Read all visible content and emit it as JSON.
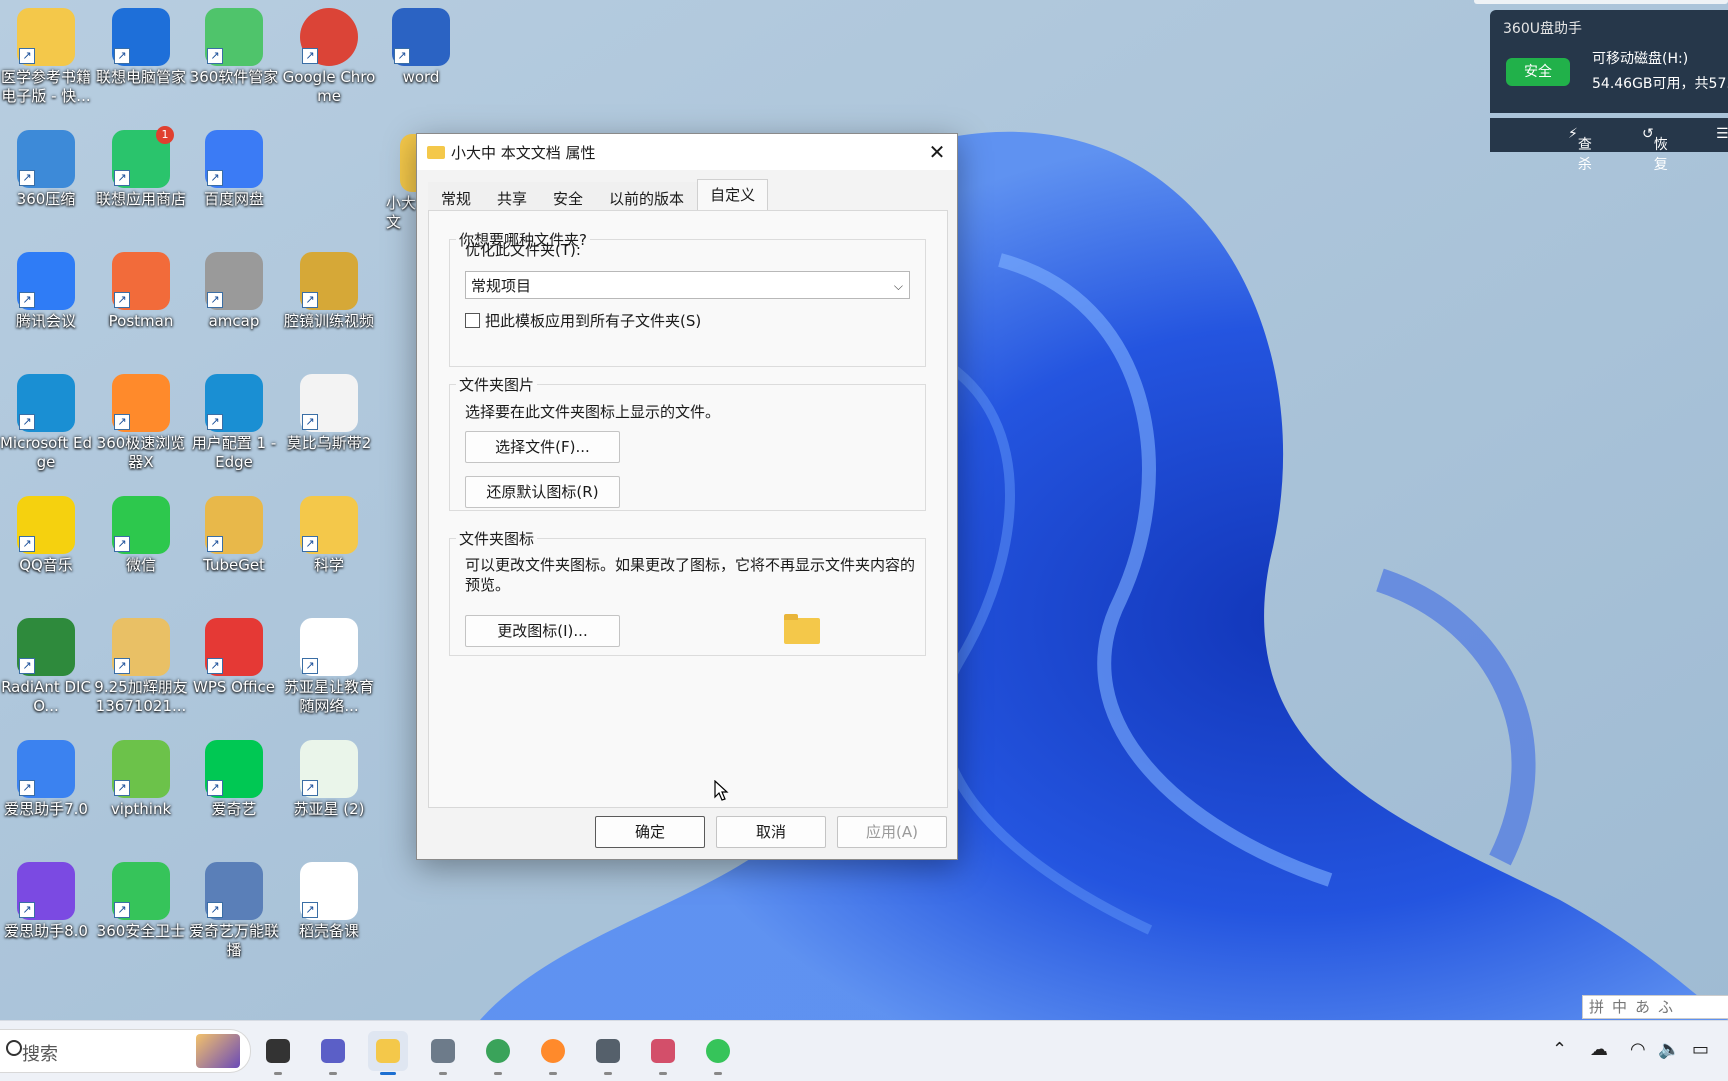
{
  "desktop": {
    "icons": [
      {
        "label": "医学参考书籍电子版 - 快...",
        "icon": "folder-icon",
        "color": "#f4c84a",
        "badge": ""
      },
      {
        "label": "联想电脑管家",
        "icon": "lenovo-pc-manager-icon",
        "color": "#1e6fd9",
        "badge": ""
      },
      {
        "label": "360软件管家",
        "icon": "360-software-manager-icon",
        "color": "#4fc46b",
        "badge": ""
      },
      {
        "label": "Google Chrome",
        "icon": "chrome-icon",
        "color": "#db4437",
        "badge": ""
      },
      {
        "label": "word",
        "icon": "word-document-icon",
        "color": "#2b63c3",
        "badge": ""
      },
      {
        "label": "360压缩",
        "icon": "360-zip-icon",
        "color": "#3d8ad8",
        "badge": ""
      },
      {
        "label": "联想应用商店",
        "icon": "lenovo-app-store-icon",
        "color": "#2ac46c",
        "badge": "1"
      },
      {
        "label": "百度网盘",
        "icon": "baidu-netdisk-icon",
        "color": "#3b7bf5",
        "badge": ""
      },
      {
        "label": "腾讯会议",
        "icon": "tencent-meeting-icon",
        "color": "#2f7cf6",
        "badge": ""
      },
      {
        "label": "Postman",
        "icon": "postman-icon",
        "color": "#f26b3a",
        "badge": ""
      },
      {
        "label": "amcap",
        "icon": "amcap-camera-icon",
        "color": "#9a9a9a",
        "badge": ""
      },
      {
        "label": "腔镜训练视频",
        "icon": "folder-icon",
        "color": "#d6a837",
        "badge": ""
      },
      {
        "label": "Microsoft Edge",
        "icon": "edge-icon",
        "color": "#1a8fd3",
        "badge": ""
      },
      {
        "label": "360极速浏览器X",
        "icon": "360-browser-icon",
        "color": "#ff8a2b",
        "badge": ""
      },
      {
        "label": "用户配置 1 - Edge",
        "icon": "edge-profile-icon",
        "color": "#1a8fd3",
        "badge": ""
      },
      {
        "label": "莫比乌斯带2",
        "icon": "image-file-icon",
        "color": "#f3f3f3",
        "badge": ""
      },
      {
        "label": "QQ音乐",
        "icon": "qq-music-icon",
        "color": "#f5d10f",
        "badge": ""
      },
      {
        "label": "微信",
        "icon": "wechat-icon",
        "color": "#2dc84d",
        "badge": ""
      },
      {
        "label": "TubeGet",
        "icon": "folder-icon",
        "color": "#e8b84a",
        "badge": ""
      },
      {
        "label": "科学",
        "icon": "folder-icon",
        "color": "#f4c84a",
        "badge": ""
      },
      {
        "label": "RadiAnt DICO...",
        "icon": "radiant-dicom-icon",
        "color": "#2e8a3c",
        "badge": ""
      },
      {
        "label": "9.25加辉朋友13671021...",
        "icon": "folder-icon",
        "color": "#e9c065",
        "badge": ""
      },
      {
        "label": "WPS Office",
        "icon": "wps-office-icon",
        "color": "#e53935",
        "badge": ""
      },
      {
        "label": "苏亚星让教育随网络...",
        "icon": "qr-code-icon",
        "color": "#ffffff",
        "badge": ""
      },
      {
        "label": "爱思助手7.0",
        "icon": "i4-assistant-icon",
        "color": "#3b82f0",
        "badge": ""
      },
      {
        "label": "vipthink",
        "icon": "vipthink-icon",
        "color": "#6cc24a",
        "badge": ""
      },
      {
        "label": "爱奇艺",
        "icon": "iqiyi-icon",
        "color": "#00c853",
        "badge": ""
      },
      {
        "label": "苏亚星 (2)",
        "icon": "png-file-icon",
        "color": "#eaf5ea",
        "badge": ""
      },
      {
        "label": "爱思助手8.0",
        "icon": "i4-assistant-icon",
        "color": "#7b4ae2",
        "badge": ""
      },
      {
        "label": "360安全卫士",
        "icon": "360-security-icon",
        "color": "#36c45a",
        "badge": ""
      },
      {
        "label": "爱奇艺万能联播",
        "icon": "iqiyi-player-icon",
        "color": "#5a7fb8",
        "badge": ""
      },
      {
        "label": "稻壳备课",
        "icon": "document-file-icon",
        "color": "#ffffff",
        "badge": ""
      }
    ],
    "partial_icon_label": "小大\n文"
  },
  "dialog": {
    "title": "小大中 本文文档 属性",
    "tabs": [
      "常规",
      "共享",
      "安全",
      "以前的版本",
      "自定义"
    ],
    "active_tab": "自定义",
    "group1": {
      "legend": "你想要哪种文件夹?",
      "optimize_label": "优化此文件夹(T):",
      "optimize_value": "常规项目",
      "apply_template_label": "把此模板应用到所有子文件夹(S)",
      "apply_template_checked": false
    },
    "group2": {
      "legend": "文件夹图片",
      "desc": "选择要在此文件夹图标上显示的文件。",
      "choose_button": "选择文件(F)...",
      "restore_button": "还原默认图标(R)"
    },
    "group3": {
      "legend": "文件夹图标",
      "desc": "可以更改文件夹图标。如果更改了图标，它将不再显示文件夹内容的预览。",
      "change_button": "更改图标(I)..."
    },
    "ok": "确定",
    "cancel": "取消",
    "apply": "应用(A)"
  },
  "u360": {
    "header": "360U盘助手",
    "status": "安全",
    "drive": "可移动磁盘(H:)",
    "space": "54.46GB可用，共57.",
    "scan": "查杀",
    "restore": "恢复"
  },
  "ime": [
    "拼",
    "中",
    "あ",
    "ふ"
  ],
  "taskbar": {
    "search_placeholder": "搜索",
    "apps": [
      {
        "name": "task-view-icon",
        "color": "#333333",
        "active": false
      },
      {
        "name": "teams-chat-icon",
        "color": "#5b5fc7",
        "active": false
      },
      {
        "name": "file-explorer-icon",
        "color": "#f4c84a",
        "active": true
      },
      {
        "name": "calculator-icon",
        "color": "#6d7b8a",
        "active": false
      },
      {
        "name": "globe-browser-icon",
        "color": "#3aa35a",
        "active": false
      },
      {
        "name": "360-browser-icon",
        "color": "#ff8a2b",
        "active": false
      },
      {
        "name": "settings-gear-icon",
        "color": "#55606b",
        "active": false
      },
      {
        "name": "snipping-tool-icon",
        "color": "#d34f6a",
        "active": false
      },
      {
        "name": "360-security-icon",
        "color": "#36c45a",
        "active": false
      }
    ],
    "tray": [
      "chevron-up-icon",
      "network-cloud-icon",
      "wifi-icon",
      "volume-icon",
      "battery-icon"
    ]
  }
}
